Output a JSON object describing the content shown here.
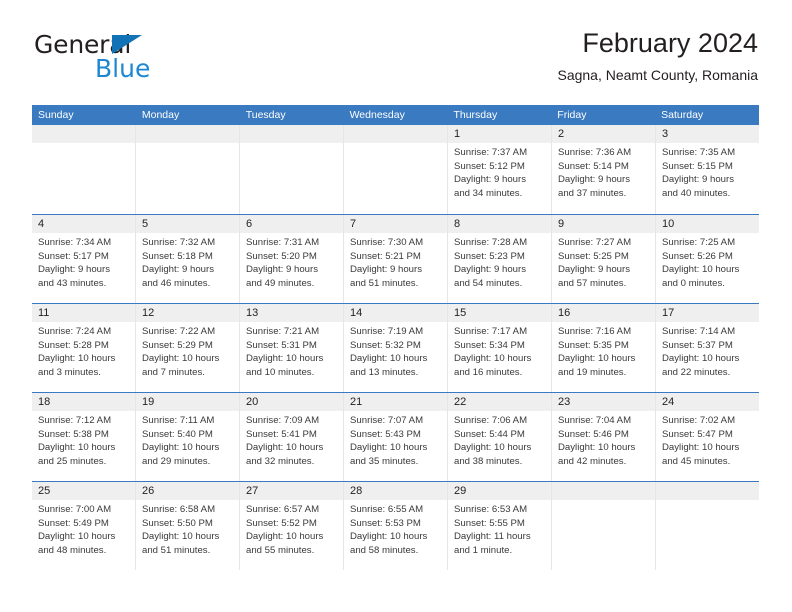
{
  "brand": {
    "name_part1": "General",
    "name_part2": "Blue",
    "triangle_icon": "triangle-icon",
    "accent_color": "#1272b6",
    "blue_text_color": "#1e87d4"
  },
  "header": {
    "title": "February 2024",
    "subtitle": "Sagna, Neamt County, Romania"
  },
  "calendar": {
    "header_color": "#3a7ac0",
    "daynum_band_color": "#efefef",
    "weekdays": [
      "Sunday",
      "Monday",
      "Tuesday",
      "Wednesday",
      "Thursday",
      "Friday",
      "Saturday"
    ],
    "weeks": [
      [
        {
          "day": "",
          "lines": []
        },
        {
          "day": "",
          "lines": []
        },
        {
          "day": "",
          "lines": []
        },
        {
          "day": "",
          "lines": []
        },
        {
          "day": "1",
          "lines": [
            "Sunrise: 7:37 AM",
            "Sunset: 5:12 PM",
            "Daylight: 9 hours",
            "and 34 minutes."
          ]
        },
        {
          "day": "2",
          "lines": [
            "Sunrise: 7:36 AM",
            "Sunset: 5:14 PM",
            "Daylight: 9 hours",
            "and 37 minutes."
          ]
        },
        {
          "day": "3",
          "lines": [
            "Sunrise: 7:35 AM",
            "Sunset: 5:15 PM",
            "Daylight: 9 hours",
            "and 40 minutes."
          ]
        }
      ],
      [
        {
          "day": "4",
          "lines": [
            "Sunrise: 7:34 AM",
            "Sunset: 5:17 PM",
            "Daylight: 9 hours",
            "and 43 minutes."
          ]
        },
        {
          "day": "5",
          "lines": [
            "Sunrise: 7:32 AM",
            "Sunset: 5:18 PM",
            "Daylight: 9 hours",
            "and 46 minutes."
          ]
        },
        {
          "day": "6",
          "lines": [
            "Sunrise: 7:31 AM",
            "Sunset: 5:20 PM",
            "Daylight: 9 hours",
            "and 49 minutes."
          ]
        },
        {
          "day": "7",
          "lines": [
            "Sunrise: 7:30 AM",
            "Sunset: 5:21 PM",
            "Daylight: 9 hours",
            "and 51 minutes."
          ]
        },
        {
          "day": "8",
          "lines": [
            "Sunrise: 7:28 AM",
            "Sunset: 5:23 PM",
            "Daylight: 9 hours",
            "and 54 minutes."
          ]
        },
        {
          "day": "9",
          "lines": [
            "Sunrise: 7:27 AM",
            "Sunset: 5:25 PM",
            "Daylight: 9 hours",
            "and 57 minutes."
          ]
        },
        {
          "day": "10",
          "lines": [
            "Sunrise: 7:25 AM",
            "Sunset: 5:26 PM",
            "Daylight: 10 hours",
            "and 0 minutes."
          ]
        }
      ],
      [
        {
          "day": "11",
          "lines": [
            "Sunrise: 7:24 AM",
            "Sunset: 5:28 PM",
            "Daylight: 10 hours",
            "and 3 minutes."
          ]
        },
        {
          "day": "12",
          "lines": [
            "Sunrise: 7:22 AM",
            "Sunset: 5:29 PM",
            "Daylight: 10 hours",
            "and 7 minutes."
          ]
        },
        {
          "day": "13",
          "lines": [
            "Sunrise: 7:21 AM",
            "Sunset: 5:31 PM",
            "Daylight: 10 hours",
            "and 10 minutes."
          ]
        },
        {
          "day": "14",
          "lines": [
            "Sunrise: 7:19 AM",
            "Sunset: 5:32 PM",
            "Daylight: 10 hours",
            "and 13 minutes."
          ]
        },
        {
          "day": "15",
          "lines": [
            "Sunrise: 7:17 AM",
            "Sunset: 5:34 PM",
            "Daylight: 10 hours",
            "and 16 minutes."
          ]
        },
        {
          "day": "16",
          "lines": [
            "Sunrise: 7:16 AM",
            "Sunset: 5:35 PM",
            "Daylight: 10 hours",
            "and 19 minutes."
          ]
        },
        {
          "day": "17",
          "lines": [
            "Sunrise: 7:14 AM",
            "Sunset: 5:37 PM",
            "Daylight: 10 hours",
            "and 22 minutes."
          ]
        }
      ],
      [
        {
          "day": "18",
          "lines": [
            "Sunrise: 7:12 AM",
            "Sunset: 5:38 PM",
            "Daylight: 10 hours",
            "and 25 minutes."
          ]
        },
        {
          "day": "19",
          "lines": [
            "Sunrise: 7:11 AM",
            "Sunset: 5:40 PM",
            "Daylight: 10 hours",
            "and 29 minutes."
          ]
        },
        {
          "day": "20",
          "lines": [
            "Sunrise: 7:09 AM",
            "Sunset: 5:41 PM",
            "Daylight: 10 hours",
            "and 32 minutes."
          ]
        },
        {
          "day": "21",
          "lines": [
            "Sunrise: 7:07 AM",
            "Sunset: 5:43 PM",
            "Daylight: 10 hours",
            "and 35 minutes."
          ]
        },
        {
          "day": "22",
          "lines": [
            "Sunrise: 7:06 AM",
            "Sunset: 5:44 PM",
            "Daylight: 10 hours",
            "and 38 minutes."
          ]
        },
        {
          "day": "23",
          "lines": [
            "Sunrise: 7:04 AM",
            "Sunset: 5:46 PM",
            "Daylight: 10 hours",
            "and 42 minutes."
          ]
        },
        {
          "day": "24",
          "lines": [
            "Sunrise: 7:02 AM",
            "Sunset: 5:47 PM",
            "Daylight: 10 hours",
            "and 45 minutes."
          ]
        }
      ],
      [
        {
          "day": "25",
          "lines": [
            "Sunrise: 7:00 AM",
            "Sunset: 5:49 PM",
            "Daylight: 10 hours",
            "and 48 minutes."
          ]
        },
        {
          "day": "26",
          "lines": [
            "Sunrise: 6:58 AM",
            "Sunset: 5:50 PM",
            "Daylight: 10 hours",
            "and 51 minutes."
          ]
        },
        {
          "day": "27",
          "lines": [
            "Sunrise: 6:57 AM",
            "Sunset: 5:52 PM",
            "Daylight: 10 hours",
            "and 55 minutes."
          ]
        },
        {
          "day": "28",
          "lines": [
            "Sunrise: 6:55 AM",
            "Sunset: 5:53 PM",
            "Daylight: 10 hours",
            "and 58 minutes."
          ]
        },
        {
          "day": "29",
          "lines": [
            "Sunrise: 6:53 AM",
            "Sunset: 5:55 PM",
            "Daylight: 11 hours",
            "and 1 minute."
          ]
        },
        {
          "day": "",
          "lines": []
        },
        {
          "day": "",
          "lines": []
        }
      ]
    ]
  }
}
